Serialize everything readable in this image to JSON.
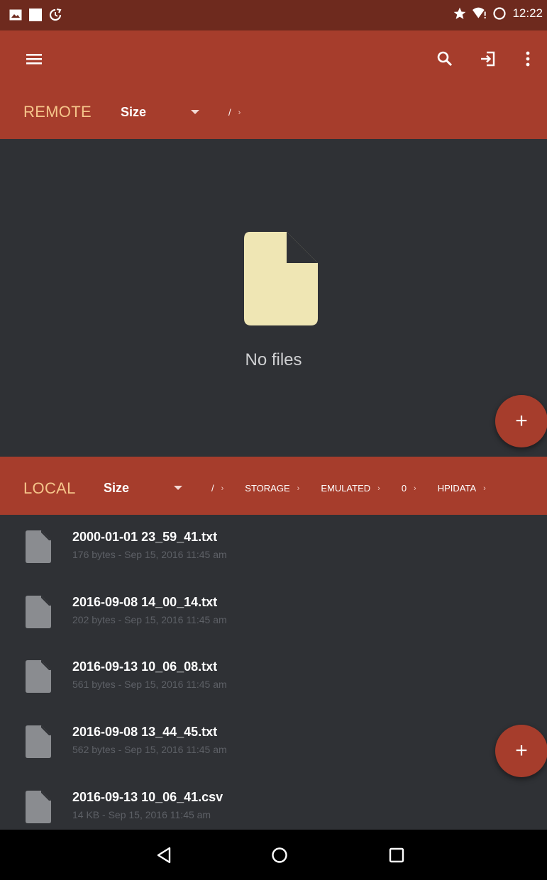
{
  "status_bar": {
    "time": "12:22",
    "left_icons": [
      "image-icon",
      "square-icon",
      "sync-icon"
    ],
    "right_icons": [
      "star-icon",
      "wifi-alert-icon",
      "battery-ring-icon"
    ]
  },
  "toolbar": {
    "icons": [
      "menu-icon",
      "search-icon",
      "login-icon",
      "more-vert-icon"
    ]
  },
  "remote": {
    "title": "REMOTE",
    "sort_label": "Size",
    "path": [
      {
        "label": "/"
      }
    ],
    "empty_text": "No files"
  },
  "local": {
    "title": "LOCAL",
    "sort_label": "Size",
    "path": [
      {
        "label": "/"
      },
      {
        "label": "STORAGE"
      },
      {
        "label": "EMULATED"
      },
      {
        "label": "0"
      },
      {
        "label": "HPIDATA"
      }
    ],
    "files": [
      {
        "name": "2000-01-01 23_59_41.txt",
        "meta": "176 bytes  -  Sep 15, 2016  11:45 am"
      },
      {
        "name": "2016-09-08 14_00_14.txt",
        "meta": "202 bytes  -  Sep 15, 2016  11:45 am"
      },
      {
        "name": "2016-09-13 10_06_08.txt",
        "meta": "561 bytes  -  Sep 15, 2016  11:45 am"
      },
      {
        "name": "2016-09-08 13_44_45.txt",
        "meta": "562 bytes  -  Sep 15, 2016  11:45 am"
      },
      {
        "name": "2016-09-13 10_06_41.csv",
        "meta": "14 KB  -  Sep 15, 2016  11:45 am"
      }
    ]
  },
  "fab": {
    "label": "+"
  },
  "colors": {
    "accent": "#a63d2c",
    "status_bar": "#6e2a1e",
    "background": "#2f3135",
    "pane_title": "#f5c58a",
    "empty_file_icon": "#efe6b4",
    "file_icon": "#8a8c90"
  },
  "nav_bar": {
    "icons": [
      "back-icon",
      "home-icon",
      "recents-icon"
    ]
  }
}
